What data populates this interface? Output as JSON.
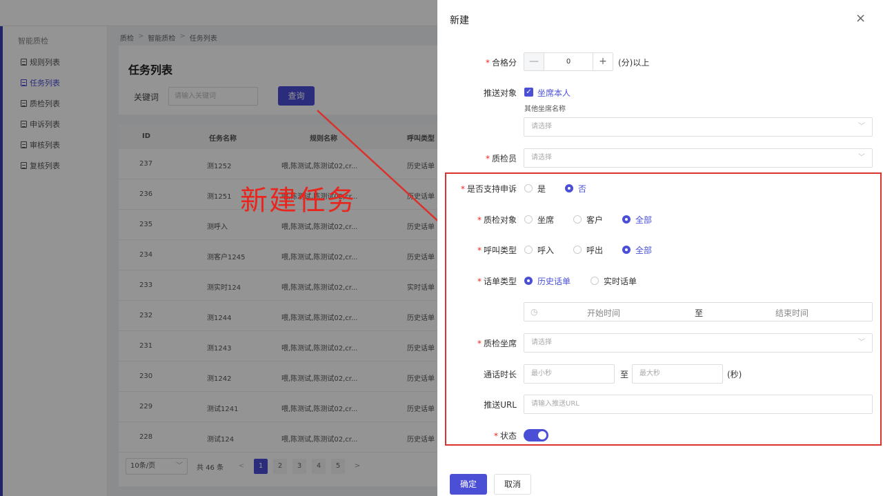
{
  "sidebar": {
    "title": "智能质检",
    "items": [
      {
        "label": "规则列表"
      },
      {
        "label": "任务列表"
      },
      {
        "label": "质检列表"
      },
      {
        "label": "申诉列表"
      },
      {
        "label": "审核列表"
      },
      {
        "label": "复核列表"
      }
    ]
  },
  "breadcrumb": [
    "质检",
    "智能质检",
    "任务列表"
  ],
  "page": {
    "title": "任务列表",
    "keyword_label": "关键词",
    "keyword_placeholder": "请输入关键词",
    "query_button": "查询"
  },
  "table": {
    "headers": [
      "ID",
      "任务名称",
      "规则名称",
      "呼叫类型"
    ],
    "rows": [
      [
        "237",
        "测1252",
        "喂,陈测试,陈测试02,cr...",
        "历史话单"
      ],
      [
        "236",
        "测1251",
        "喂,陈测试,陈测试02,cr...",
        "历史话单"
      ],
      [
        "235",
        "测呼入",
        "喂,陈测试,陈测试02,cr...",
        "历史话单"
      ],
      [
        "234",
        "测客户1245",
        "喂,陈测试,陈测试02,cr...",
        "历史话单"
      ],
      [
        "233",
        "测实时124",
        "喂,陈测试,陈测试02,cr...",
        "实时话单"
      ],
      [
        "232",
        "测1244",
        "喂,陈测试,陈测试02,cr...",
        "历史话单"
      ],
      [
        "231",
        "测1243",
        "喂,陈测试,陈测试02,cr...",
        "历史话单"
      ],
      [
        "230",
        "测1242",
        "喂,陈测试,陈测试02,cr...",
        "历史话单"
      ],
      [
        "229",
        "测试1241",
        "喂,陈测试,陈测试02,cr...",
        "历史话单"
      ],
      [
        "228",
        "测试124",
        "喂,陈测试,陈测试02,cr...",
        "历史话单"
      ]
    ]
  },
  "pager": {
    "page_size": "10条/页",
    "total": "共 46 条",
    "prev": "<",
    "next": ">",
    "pages": [
      "1",
      "2",
      "3",
      "4",
      "5"
    ],
    "current": "1"
  },
  "annotation": "新建任务",
  "drawer": {
    "title": "新建",
    "close": "×",
    "pass_score": {
      "label": "合格分",
      "minus": "—",
      "value": "0",
      "plus": "+",
      "suffix": "(分)以上"
    },
    "push_target": {
      "label": "推送对象",
      "checkbox_label": "坐席本人",
      "check": "✓",
      "other_label": "其他坐席名称",
      "placeholder": "请选择"
    },
    "inspector": {
      "label": "质检员",
      "placeholder": "请选择"
    },
    "appeal": {
      "label": "是否支持申诉",
      "options": [
        "是",
        "否"
      ],
      "selected": "否"
    },
    "inspect_target": {
      "label": "质检对象",
      "options": [
        "坐席",
        "客户",
        "全部"
      ],
      "selected": "全部"
    },
    "call_type": {
      "label": "呼叫类型",
      "options": [
        "呼入",
        "呼出",
        "全部"
      ],
      "selected": "全部"
    },
    "bill_type": {
      "label": "话单类型",
      "options": [
        "历史话单",
        "实时话单"
      ],
      "selected": "历史话单"
    },
    "time_range": {
      "clock": "◷",
      "start": "开始时间",
      "to": "至",
      "end": "结束时间"
    },
    "inspect_agent": {
      "label": "质检坐席",
      "placeholder": "请选择"
    },
    "duration": {
      "label": "通话时长",
      "min_placeholder": "最小秒",
      "to": "至",
      "max_placeholder": "最大秒",
      "suffix": "(秒)"
    },
    "push_url": {
      "label": "推送URL",
      "placeholder": "请输入推送URL"
    },
    "status": {
      "label": "状态",
      "on": true
    },
    "ok": "确定",
    "cancel": "取消",
    "chevron": "﹀"
  },
  "colors": {
    "primary": "#4a4fd6",
    "annotation": "#e8261e"
  }
}
